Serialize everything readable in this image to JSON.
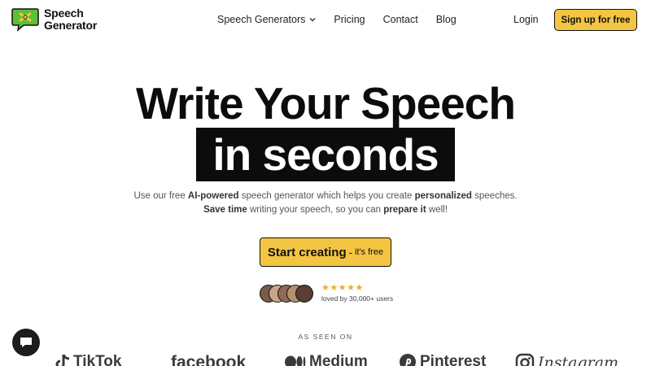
{
  "brand": {
    "line1": "Speech",
    "line2": "Generator"
  },
  "nav": {
    "links": [
      "Speech Generators",
      "Pricing",
      "Contact",
      "Blog"
    ],
    "login": "Login",
    "signup": "Sign up for free"
  },
  "hero": {
    "title_line1": "Write Your Speech",
    "title_line2": "in seconds",
    "sub_line1": {
      "a": "Use our free ",
      "b": "AI-powered",
      "c": " speech generator which helps you create ",
      "d": "personalized",
      "e": " speeches."
    },
    "sub_line2": {
      "a": "Save time",
      "b": " writing your speech, so you can ",
      "c": "prepare it",
      "d": " well!"
    },
    "cta_main": "Start creating",
    "cta_sep": "-",
    "cta_note": "it's free",
    "stars": "★★★★★",
    "rating_value": 5,
    "loved": "loved by 30,000+ users"
  },
  "seen_on": {
    "label": "AS SEEN ON",
    "brands": [
      "TikTok",
      "facebook",
      "Medium",
      "Pinterest",
      "Instagram"
    ]
  },
  "colors": {
    "accent": "#f4c542",
    "dark": "#0c0c0c",
    "logo_green": "#5bbf3a",
    "star": "#f0a830"
  },
  "icons": {
    "logo": "speech-bubble-logo-icon",
    "chevron": "chevron-down-icon",
    "chat": "chat-bubble-icon"
  }
}
